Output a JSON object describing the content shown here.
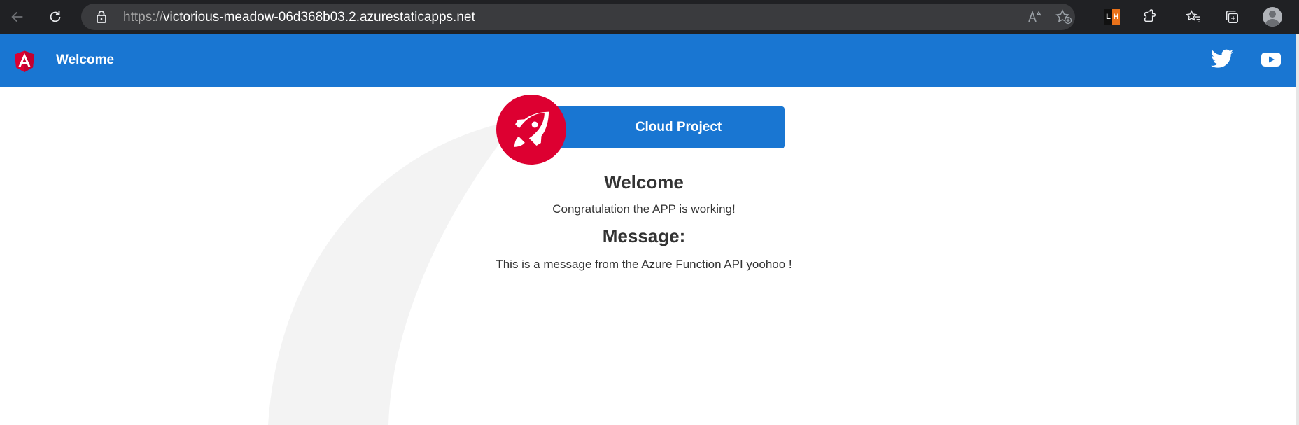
{
  "browser": {
    "url_protocol": "https://",
    "url_host": "victorious-meadow-06d368b03.2.azurestaticapps.net",
    "extension_label_left": "L",
    "extension_label_right": "H"
  },
  "toolbar": {
    "title": "Welcome",
    "background": "#1976d2"
  },
  "card": {
    "label": "Cloud Project",
    "icon": "rocket-icon",
    "icon_background": "#dd0031"
  },
  "content": {
    "welcome_heading": "Welcome",
    "welcome_text": "Congratulation the APP is working!",
    "message_heading": "Message:",
    "message_text": "This is a message from the Azure Function API yoohoo !"
  }
}
